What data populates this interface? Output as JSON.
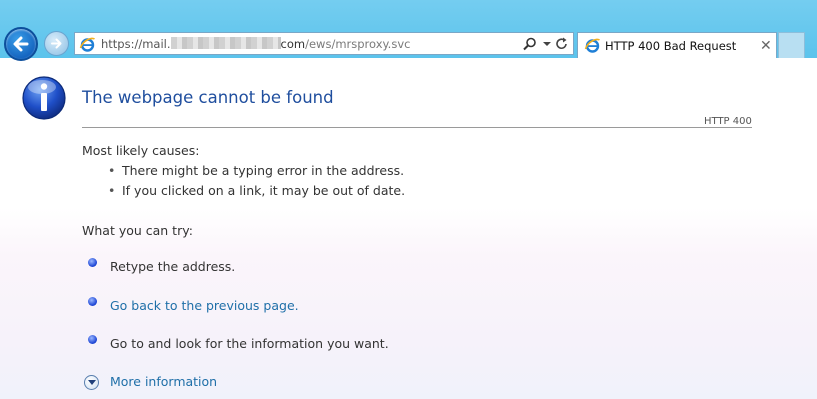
{
  "browser": {
    "address": {
      "prefix": "https://mail.",
      "domain_tail": "com",
      "path": "/ews/mrsproxy.svc"
    },
    "tab": {
      "title": "HTTP 400 Bad Request",
      "close_glyph": "✕"
    },
    "colors": {
      "chrome": "#5bc3ec",
      "back_button": "#1565c0"
    }
  },
  "page": {
    "title": "The webpage cannot be found",
    "status_code": "HTTP 400",
    "causes_heading": "Most likely causes:",
    "causes": [
      "There might be a typing error in the address.",
      "If you clicked on a link, it may be out of date."
    ],
    "bullet": "•",
    "try_heading": "What you can try:",
    "suggestions": [
      "Retype the address.",
      "Go back to the previous page.",
      "Go to  and look for the information you want."
    ],
    "more_info": "More information",
    "colors": {
      "title": "#1f4e9e",
      "link": "#1f6fa8"
    }
  }
}
